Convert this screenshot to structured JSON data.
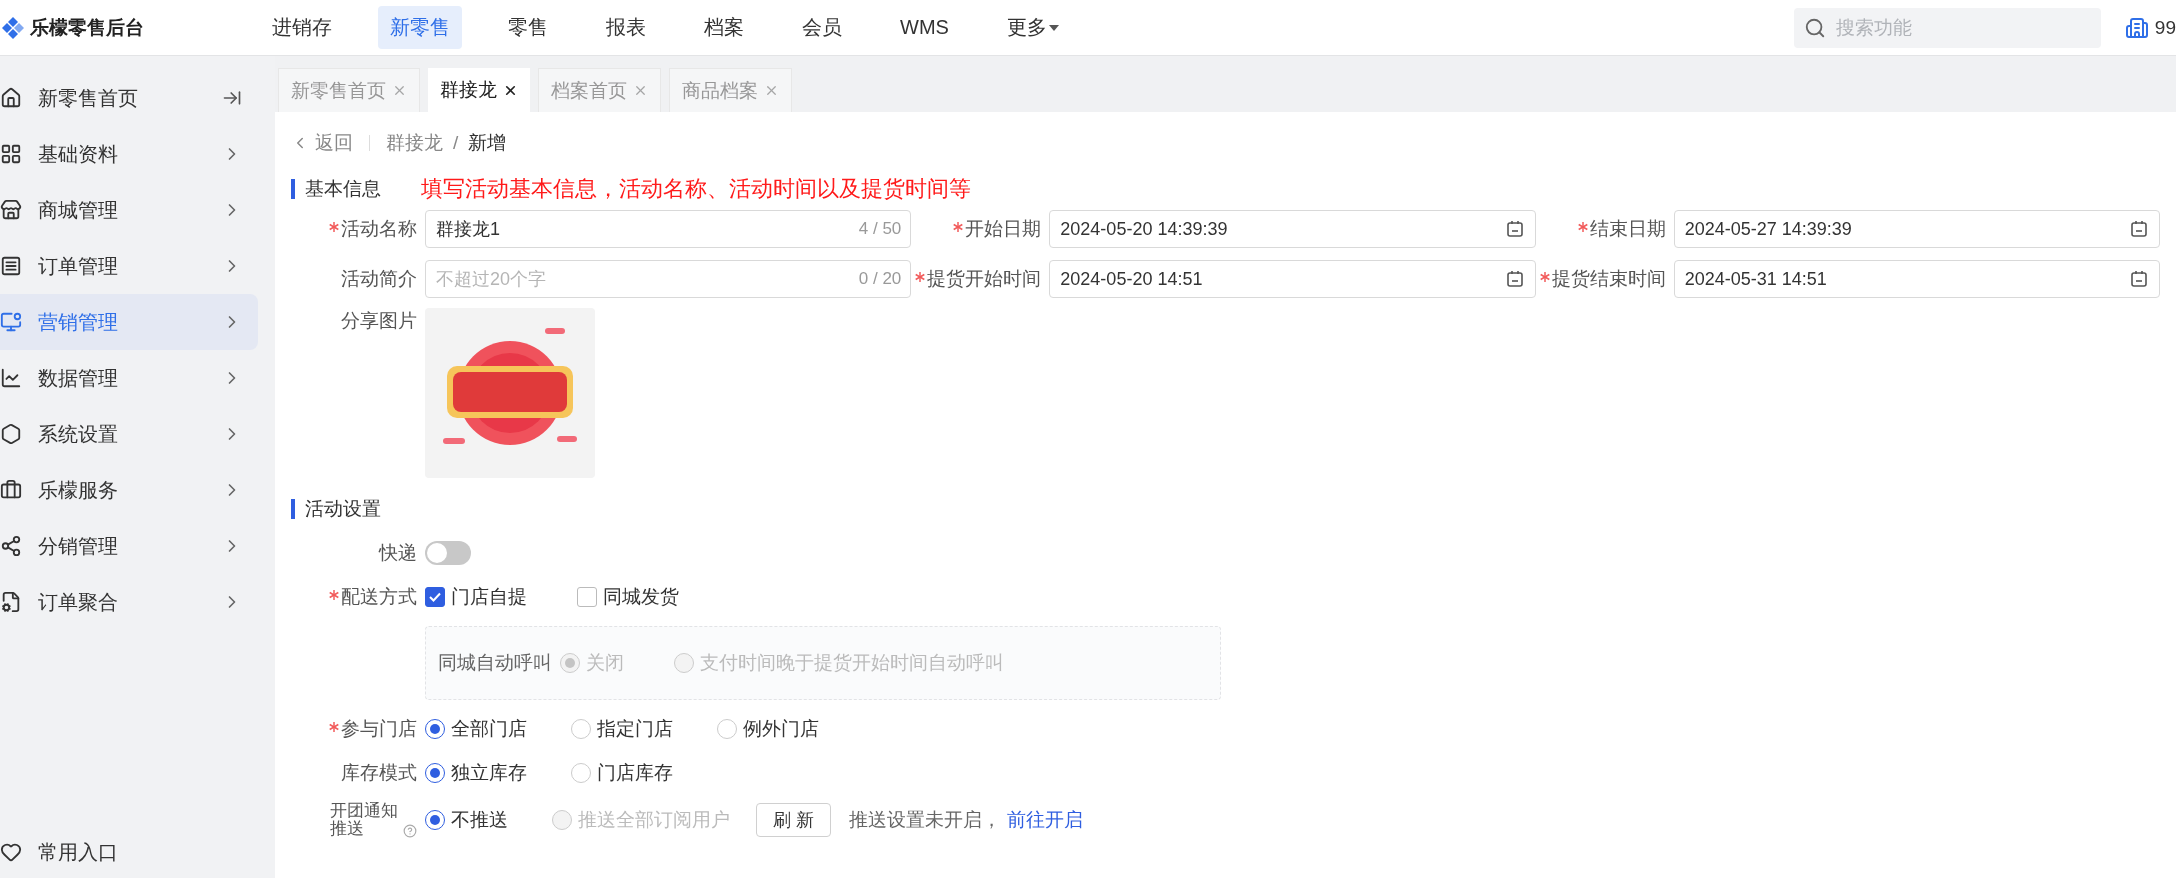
{
  "app": {
    "name": "乐檬零售后台"
  },
  "top_nav": [
    {
      "label": "进销存",
      "selected": false,
      "kind": "link"
    },
    {
      "label": "新零售",
      "selected": true,
      "kind": "link"
    },
    {
      "label": "零售",
      "selected": false,
      "kind": "link"
    },
    {
      "label": "报表",
      "selected": false,
      "kind": "link"
    },
    {
      "label": "档案",
      "selected": false,
      "kind": "link"
    },
    {
      "label": "会员",
      "selected": false,
      "kind": "link"
    },
    {
      "label": "WMS",
      "selected": false,
      "kind": "link"
    },
    {
      "label": "更多",
      "selected": false,
      "kind": "dropdown"
    }
  ],
  "search": {
    "placeholder": "搜索功能"
  },
  "account": {
    "text": "99"
  },
  "sidebar": {
    "items": [
      {
        "label": "新零售首页",
        "selected": false,
        "kind": "collapse"
      },
      {
        "label": "基础资料",
        "selected": false,
        "kind": "menu"
      },
      {
        "label": "商城管理",
        "selected": false,
        "kind": "menu"
      },
      {
        "label": "订单管理",
        "selected": false,
        "kind": "menu"
      },
      {
        "label": "营销管理",
        "selected": true,
        "kind": "menu"
      },
      {
        "label": "数据管理",
        "selected": false,
        "kind": "menu"
      },
      {
        "label": "系统设置",
        "selected": false,
        "kind": "menu"
      },
      {
        "label": "乐檬服务",
        "selected": false,
        "kind": "menu"
      },
      {
        "label": "分销管理",
        "selected": false,
        "kind": "menu"
      },
      {
        "label": "订单聚合",
        "selected": false,
        "kind": "menu"
      }
    ],
    "footer": {
      "label": "常用入口"
    }
  },
  "tabs": [
    {
      "label": "新零售首页",
      "selected": false
    },
    {
      "label": "群接龙",
      "selected": true
    },
    {
      "label": "档案首页",
      "selected": false
    },
    {
      "label": "商品档案",
      "selected": false
    }
  ],
  "breadcrumb": {
    "back": "返回",
    "path": [
      "群接龙",
      "新增"
    ],
    "separator": "/"
  },
  "basic_info": {
    "title": "基本信息",
    "note": "填写活动基本信息，活动名称、活动时间以及提货时间等",
    "fields": [
      {
        "label": "活动名称",
        "required": true,
        "kind": "text",
        "value": "群接龙1",
        "counter": "4 / 50"
      },
      {
        "label": "开始日期",
        "required": true,
        "kind": "date",
        "value": "2024-05-20 14:39:39"
      },
      {
        "label": "结束日期",
        "required": true,
        "kind": "date",
        "value": "2024-05-27 14:39:39"
      },
      {
        "label": "活动简介",
        "required": false,
        "kind": "text",
        "placeholder": "不超过20个字",
        "counter": "0 / 20"
      },
      {
        "label": "提货开始时间",
        "required": true,
        "kind": "date",
        "value": "2024-05-20 14:51"
      },
      {
        "label": "提货结束时间",
        "required": true,
        "kind": "date",
        "value": "2024-05-31 14:51"
      }
    ],
    "image_field": {
      "label": "分享图片"
    }
  },
  "settings": {
    "title": "活动设置",
    "rows": [
      {
        "kind": "switch",
        "label": "快递",
        "required": false,
        "on": false
      },
      {
        "kind": "checkboxes",
        "label": "配送方式",
        "required": true,
        "options": [
          {
            "label": "门店自提",
            "checked": true
          },
          {
            "label": "同城发货",
            "checked": false
          }
        ]
      },
      {
        "kind": "panel",
        "label": "同城自动呼叫",
        "options": [
          {
            "label": "关闭",
            "selected": true,
            "disabled": true
          },
          {
            "label": "支付时间晚于提货开始时间自动呼叫",
            "selected": false,
            "disabled": true
          }
        ]
      },
      {
        "kind": "radios",
        "label": "参与门店",
        "required": true,
        "options": [
          {
            "label": "全部门店",
            "selected": true,
            "disabled": false
          },
          {
            "label": "指定门店",
            "selected": false,
            "disabled": false
          },
          {
            "label": "例外门店",
            "selected": false,
            "disabled": false
          }
        ]
      },
      {
        "kind": "radios",
        "label": "库存模式",
        "required": false,
        "options": [
          {
            "label": "独立库存",
            "selected": true,
            "disabled": false
          },
          {
            "label": "门店库存",
            "selected": false,
            "disabled": false
          }
        ]
      },
      {
        "kind": "push",
        "label": "开团通知推送",
        "required": false,
        "help": true,
        "options": [
          {
            "label": "不推送",
            "selected": true,
            "disabled": false
          },
          {
            "label": "推送全部订阅用户",
            "selected": false,
            "disabled": true
          }
        ],
        "button": "刷 新",
        "note": "推送设置未开启，",
        "link": "前往开启"
      }
    ]
  }
}
